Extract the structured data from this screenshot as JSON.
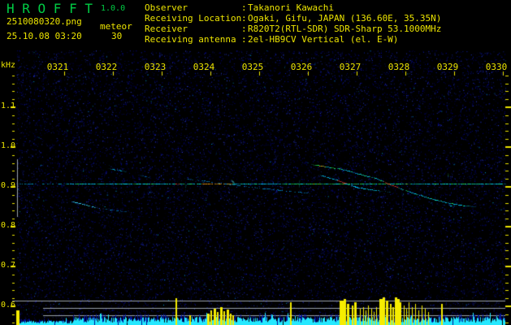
{
  "header": {
    "title": "H R O F F T",
    "version": "1.0.0",
    "filename": "2510080320.png",
    "mode": "meteor",
    "datetime": "25.10.08 03:20",
    "param": "30",
    "colon": ":",
    "info_rows": [
      {
        "label": "Observer",
        "value": "Takanori Kawachi"
      },
      {
        "label": "Receiving Location",
        "value": "Ogaki, Gifu, JAPAN (136.60E, 35.35N)"
      },
      {
        "label": "Receiver",
        "value": "R820T2(RTL-SDR) SDR-Sharp 53.1000MHz"
      },
      {
        "label": "Receiving antenna",
        "value": "2el-HB9CV Vertical (el. E-W)"
      }
    ]
  },
  "chart_data": {
    "type": "heatmap",
    "subtype": "meteor-radio-spectrogram-with-amplitude-strip",
    "x_tick_labels": [
      "0321",
      "0322",
      "0323",
      "0324",
      "0325",
      "0326",
      "0327",
      "0328",
      "0329",
      "0330"
    ],
    "x_minutes_after_0320": [
      0,
      10
    ],
    "y_unit_label": "kHz",
    "y_tick_labels": [
      "1.1",
      "1.0",
      "0.9",
      "0.8",
      "0.7",
      "0.6"
    ],
    "y_range_khz": [
      0.55,
      1.24
    ],
    "carrier_khz": 0.908,
    "noise": {
      "seed": 7
    },
    "traces": [
      {
        "name": "carrier-dim",
        "points": [
          [
            0.03,
            0.908
          ],
          [
            1.0,
            0.908
          ]
        ],
        "color": "#0099cc",
        "density": 0.5,
        "taper": 3
      },
      {
        "name": "carrier-main",
        "points": [
          [
            1.0,
            0.908
          ],
          [
            5.43,
            0.908
          ]
        ],
        "color": "#00d8ff",
        "density": 0.97,
        "greenmix": 0.22,
        "taper": 3,
        "hot": [
          [
            3.27,
            3.33,
            "#ff4433"
          ],
          [
            3.8,
            4.42,
            "#ffaa00"
          ]
        ]
      },
      {
        "name": "carrier-bright",
        "points": [
          [
            5.43,
            0.908
          ],
          [
            8.05,
            0.908
          ]
        ],
        "color": "#00e8ff",
        "density": 1,
        "greenmix": 0.6,
        "yellowmix": 0.05,
        "taper": 3
      },
      {
        "name": "carrier-right",
        "points": [
          [
            8.05,
            0.908
          ],
          [
            10.03,
            0.908
          ]
        ],
        "color": "#00d8ff",
        "density": 0.97,
        "greenmix": 0.3,
        "taper": 3,
        "hot": [
          [
            9.13,
            9.22,
            "#22ee66"
          ]
        ]
      },
      {
        "name": "echo-a1",
        "points": [
          [
            1.08,
            0.865
          ],
          [
            1.7,
            0.847
          ]
        ],
        "color": "#33ddff",
        "density": 0.85
      },
      {
        "name": "echo-a2",
        "points": [
          [
            1.7,
            0.847
          ],
          [
            2.33,
            0.837
          ]
        ],
        "color": "#0077bb",
        "density": 0.4
      },
      {
        "name": "streak-b",
        "points": [
          [
            1.88,
            0.947
          ],
          [
            2.25,
            0.939
          ]
        ],
        "color": "#00bbee",
        "density": 0.75
      },
      {
        "name": "streak-c",
        "points": [
          [
            2.5,
            0.931
          ],
          [
            2.75,
            0.924
          ]
        ],
        "color": "#0077bb",
        "density": 0.5
      },
      {
        "name": "streak-j",
        "points": [
          [
            1.72,
            0.961
          ],
          [
            1.95,
            0.953
          ]
        ],
        "color": "#005599",
        "density": 0.4
      },
      {
        "name": "drift-k",
        "points": [
          [
            3.42,
            0.922
          ],
          [
            4.08,
            0.912
          ],
          [
            4.67,
            0.902
          ],
          [
            5.42,
            0.892
          ],
          [
            6.03,
            0.884
          ]
        ],
        "color": "#0088cc",
        "density": 0.45
      },
      {
        "name": "head-echo-d",
        "points": [
          [
            6.05,
            0.957
          ],
          [
            6.67,
            0.945
          ],
          [
            7.08,
            0.931
          ],
          [
            7.38,
            0.922
          ],
          [
            7.63,
            0.908
          ],
          [
            7.88,
            0.896
          ],
          [
            8.17,
            0.884
          ],
          [
            8.5,
            0.871
          ],
          [
            8.83,
            0.861
          ],
          [
            9.08,
            0.855
          ],
          [
            9.42,
            0.851
          ]
        ],
        "color": "#00ccff",
        "density": 0.9,
        "greenmix": 0.25,
        "hot": [
          [
            6.08,
            6.35,
            "#22ee55"
          ],
          [
            7.52,
            7.82,
            "#ff4433"
          ]
        ]
      },
      {
        "name": "head-echo-e",
        "points": [
          [
            6.2,
            0.931
          ],
          [
            6.62,
            0.916
          ],
          [
            6.95,
            0.9
          ],
          [
            7.25,
            0.894
          ],
          [
            7.5,
            0.89
          ]
        ],
        "color": "#00ccff",
        "density": 0.85,
        "hot": [
          [
            6.57,
            6.76,
            "#ff4433"
          ]
        ]
      },
      {
        "name": "echo-e-tail",
        "points": [
          [
            7.5,
            0.89
          ],
          [
            7.75,
            0.886
          ]
        ],
        "color": "#0088cc",
        "density": 0.4
      },
      {
        "name": "dash-g",
        "points": [
          [
            5.8,
            0.918
          ],
          [
            5.8,
            0.898
          ]
        ],
        "color": "#00ddff",
        "density": 1
      },
      {
        "name": "dash-m",
        "points": [
          [
            3.47,
            0.906
          ],
          [
            3.47,
            0.894
          ]
        ],
        "color": "#00ddff",
        "density": 0.9
      },
      {
        "name": "dash-n",
        "points": [
          [
            5.53,
            0.912
          ],
          [
            5.53,
            0.904
          ]
        ],
        "color": "#33ff55",
        "density": 1
      },
      {
        "name": "dash-h",
        "points": [
          [
            8.85,
            0.935
          ],
          [
            8.85,
            0.924
          ]
        ],
        "color": "#33ff55",
        "density": 1
      },
      {
        "name": "blob",
        "points": [
          [
            4.4,
            0.919
          ],
          [
            4.47,
            0.909
          ]
        ],
        "color": "#55eeff",
        "density": 1,
        "thick": true
      },
      {
        "name": "dot-i",
        "points": [
          [
            8.75,
            0.855
          ],
          [
            9.03,
            0.853
          ]
        ],
        "color": "#00ccff",
        "density": 0.8
      }
    ],
    "amplitude_spikes": [
      [
        0.0,
        4,
        18
      ],
      [
        3.27,
        2,
        33
      ],
      [
        3.55,
        2,
        12
      ],
      [
        3.92,
        3,
        14
      ],
      [
        3.98,
        2,
        18
      ],
      [
        4.05,
        3,
        20
      ],
      [
        4.12,
        2,
        16
      ],
      [
        4.18,
        3,
        22
      ],
      [
        4.25,
        2,
        17
      ],
      [
        4.32,
        3,
        19
      ],
      [
        4.38,
        2,
        14
      ],
      [
        4.43,
        2,
        12
      ],
      [
        5.62,
        2,
        28
      ],
      [
        6.63,
        5,
        30
      ],
      [
        6.72,
        3,
        32
      ],
      [
        6.78,
        3,
        26
      ],
      [
        6.88,
        2,
        24
      ],
      [
        6.93,
        3,
        28
      ],
      [
        7.05,
        1,
        20
      ],
      [
        7.12,
        1,
        22
      ],
      [
        7.17,
        1,
        18
      ],
      [
        7.22,
        1,
        24
      ],
      [
        7.28,
        1,
        20
      ],
      [
        7.33,
        1,
        16
      ],
      [
        7.38,
        1,
        22
      ],
      [
        7.45,
        4,
        32
      ],
      [
        7.52,
        3,
        34
      ],
      [
        7.58,
        3,
        30
      ],
      [
        7.67,
        2,
        26
      ],
      [
        7.72,
        2,
        22
      ],
      [
        7.77,
        3,
        34
      ],
      [
        7.82,
        3,
        32
      ],
      [
        7.87,
        2,
        28
      ],
      [
        7.95,
        1,
        24
      ],
      [
        8.0,
        1,
        20
      ],
      [
        8.05,
        1,
        28
      ],
      [
        8.12,
        1,
        22
      ],
      [
        8.18,
        1,
        26
      ],
      [
        8.25,
        1,
        18
      ],
      [
        8.32,
        1,
        24
      ],
      [
        8.38,
        1,
        20
      ],
      [
        8.45,
        1,
        16
      ],
      [
        8.72,
        2,
        26
      ]
    ],
    "amplitude_panel": {
      "ref_line_count": 3
    }
  },
  "colors": {
    "background": "#000000",
    "axis_yellow": "#ece400",
    "title_green": "#00cc44",
    "noise_blue": "#0000bb",
    "carrier_cyan": "#00d8ff",
    "echo_green": "#22ee55",
    "hot_red": "#ff4433",
    "gray_line": "#9aa2aa",
    "bar_navy": "#0013a8",
    "bar_cyan": "#25e8ff",
    "spike_yellow": "#f6ec00"
  }
}
